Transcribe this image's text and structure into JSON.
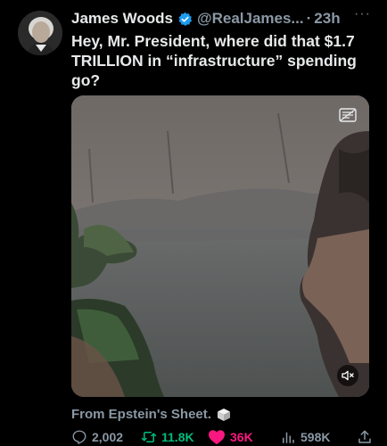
{
  "tweet": {
    "author_name": "James Woods",
    "author_handle": "@RealJames...",
    "separator": "·",
    "time": "23h",
    "more_label": "···",
    "text": "Hey, Mr. President, where did that $1.7 TRILLION in “infrastructure” spending go?",
    "caption": "From Epstein's Sheet.",
    "stats": {
      "replies": "2,002",
      "retweets": "11.8K",
      "likes": "36K",
      "views": "598K"
    }
  },
  "icons": {
    "verified": "verified-badge-icon",
    "reply": "reply-icon",
    "retweet": "retweet-icon",
    "like": "heart-icon",
    "views": "views-chart-icon",
    "share": "share-icon",
    "mute": "muted-speaker-icon",
    "gif": "gif-icon",
    "cube": "cube-emoji-icon"
  },
  "colors": {
    "background": "#000000",
    "text": "#e7e9ea",
    "secondary": "#8b98a5",
    "verified": "#1d9bf0",
    "retweet": "#00ba7c",
    "like": "#f91880"
  }
}
